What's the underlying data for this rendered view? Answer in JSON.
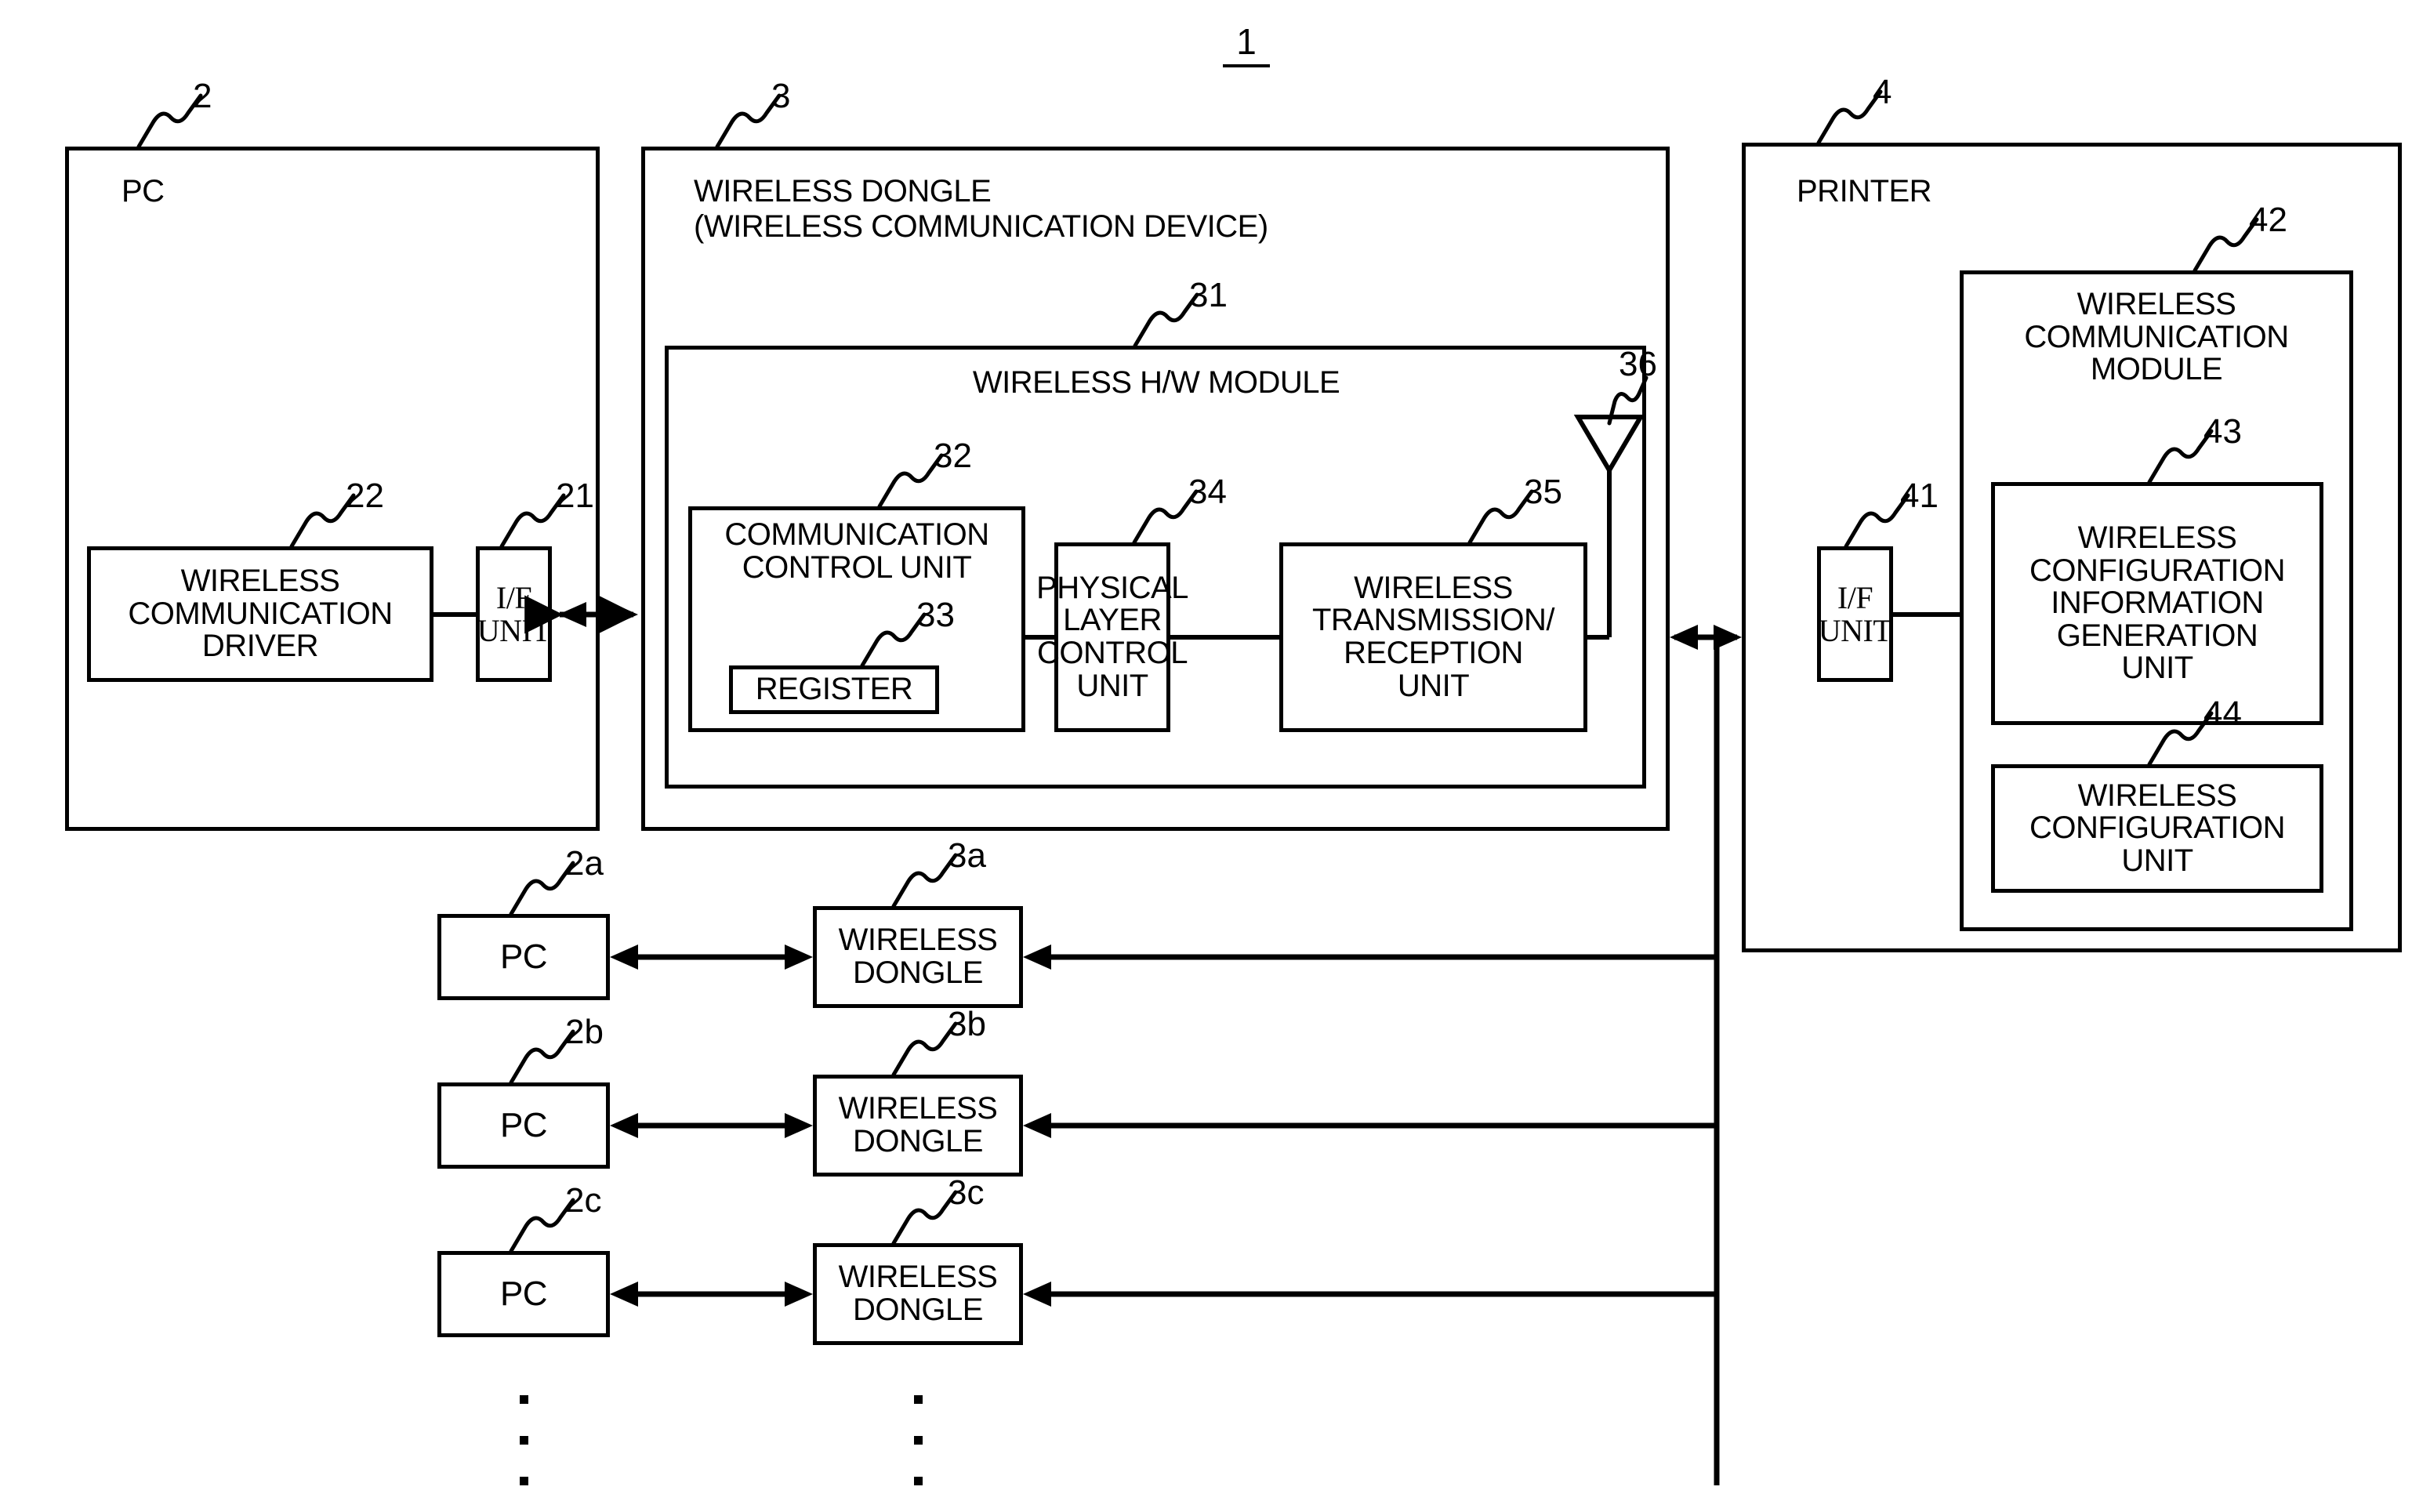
{
  "figure": {
    "number": "1"
  },
  "pc": {
    "ref": "2",
    "title": "PC",
    "driver": {
      "ref": "22",
      "label": "WIRELESS\nCOMMUNICATION\nDRIVER"
    },
    "if_unit": {
      "ref": "21",
      "label": "I/F\nUNIT"
    }
  },
  "dongle": {
    "ref": "3",
    "title": "WIRELESS DONGLE\n(WIRELESS COMMUNICATION DEVICE)",
    "hw_module": {
      "ref": "31",
      "title": "WIRELESS H/W MODULE",
      "comm_control": {
        "ref": "32",
        "label": "COMMUNICATION\nCONTROL UNIT"
      },
      "register": {
        "ref": "33",
        "label": "REGISTER"
      },
      "phy_control": {
        "ref": "34",
        "label": "PHYSICAL\nLAYER\nCONTROL\nUNIT"
      },
      "tx_rx": {
        "ref": "35",
        "label": "WIRELESS\nTRANSMISSION/\nRECEPTION\nUNIT"
      },
      "antenna": {
        "ref": "36",
        "name": "antenna"
      }
    }
  },
  "printer": {
    "ref": "4",
    "title": "PRINTER",
    "if_unit": {
      "ref": "41",
      "label": "I/F\nUNIT"
    },
    "wireless_module": {
      "ref": "42",
      "label": "WIRELESS\nCOMMUNICATION\nMODULE",
      "config_info_gen": {
        "ref": "43",
        "label": "WIRELESS\nCONFIGURATION\nINFORMATION\nGENERATION\nUNIT"
      },
      "config_unit": {
        "ref": "44",
        "label": "WIRELESS\nCONFIGURATION\nUNIT"
      }
    }
  },
  "extra_rows": [
    {
      "pc": {
        "ref": "2a",
        "label": "PC"
      },
      "dongle": {
        "ref": "3a",
        "label": "WIRELESS\nDONGLE"
      }
    },
    {
      "pc": {
        "ref": "2b",
        "label": "PC"
      },
      "dongle": {
        "ref": "3b",
        "label": "WIRELESS\nDONGLE"
      }
    },
    {
      "pc": {
        "ref": "2c",
        "label": "PC"
      },
      "dongle": {
        "ref": "3c",
        "label": "WIRELESS\nDONGLE"
      }
    }
  ]
}
